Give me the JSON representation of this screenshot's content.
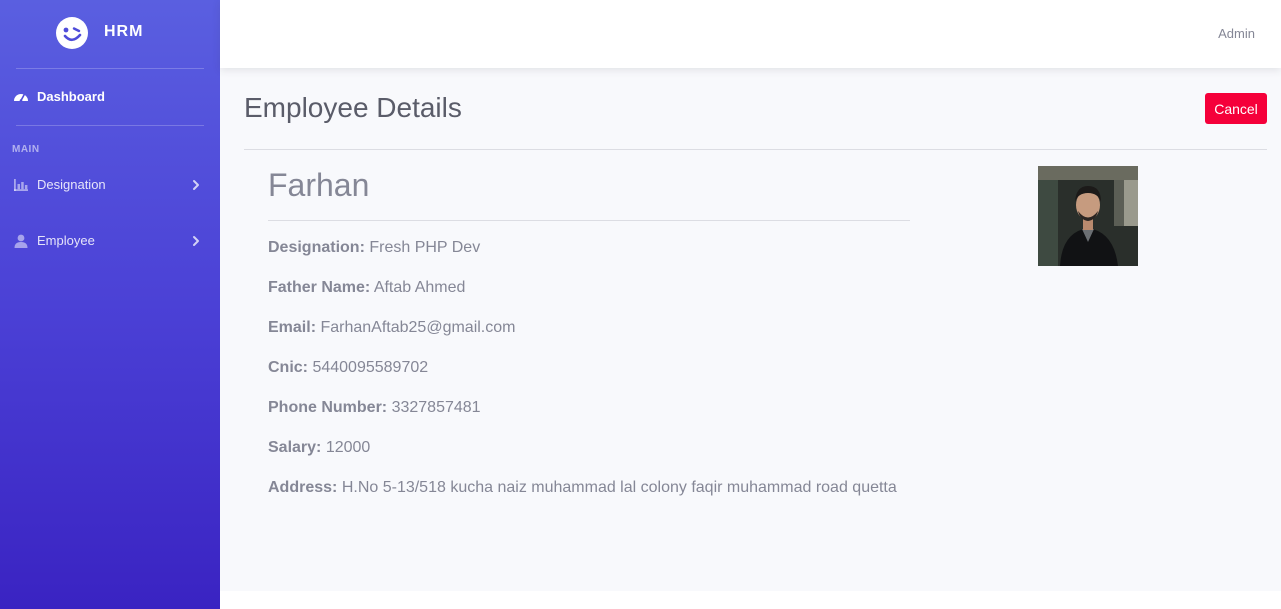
{
  "brand": {
    "name": "HRM",
    "logo_icon": "winking-face-icon"
  },
  "sidebar": {
    "dashboard": {
      "label": "Dashboard",
      "icon": "speedometer-icon"
    },
    "section_heading": "MAIN",
    "items": [
      {
        "label": "Designation",
        "icon": "bar-chart-icon"
      },
      {
        "label": "Employee",
        "icon": "user-icon"
      }
    ]
  },
  "topbar": {
    "user": "Admin"
  },
  "page": {
    "title": "Employee Details",
    "cancel_label": "Cancel"
  },
  "employee": {
    "name": "Farhan",
    "fields": [
      {
        "label": "Designation:",
        "value": "Fresh PHP Dev"
      },
      {
        "label": "Father Name:",
        "value": "Aftab Ahmed"
      },
      {
        "label": "Email:",
        "value": "FarhanAftab25@gmail.com"
      },
      {
        "label": "Cnic:",
        "value": "5440095589702"
      },
      {
        "label": "Phone Number:",
        "value": "3327857481"
      },
      {
        "label": "Salary:",
        "value": "12000"
      },
      {
        "label": "Address:",
        "value": "H.No 5-13/518 kucha naiz muhammad lal colony faqir muhammad road quetta"
      }
    ]
  },
  "colors": {
    "sidebar_top": "#5a5fe0",
    "sidebar_bottom": "#3a23c2",
    "cancel_button": "#f5003a",
    "content_bg": "#f8f9fc"
  }
}
